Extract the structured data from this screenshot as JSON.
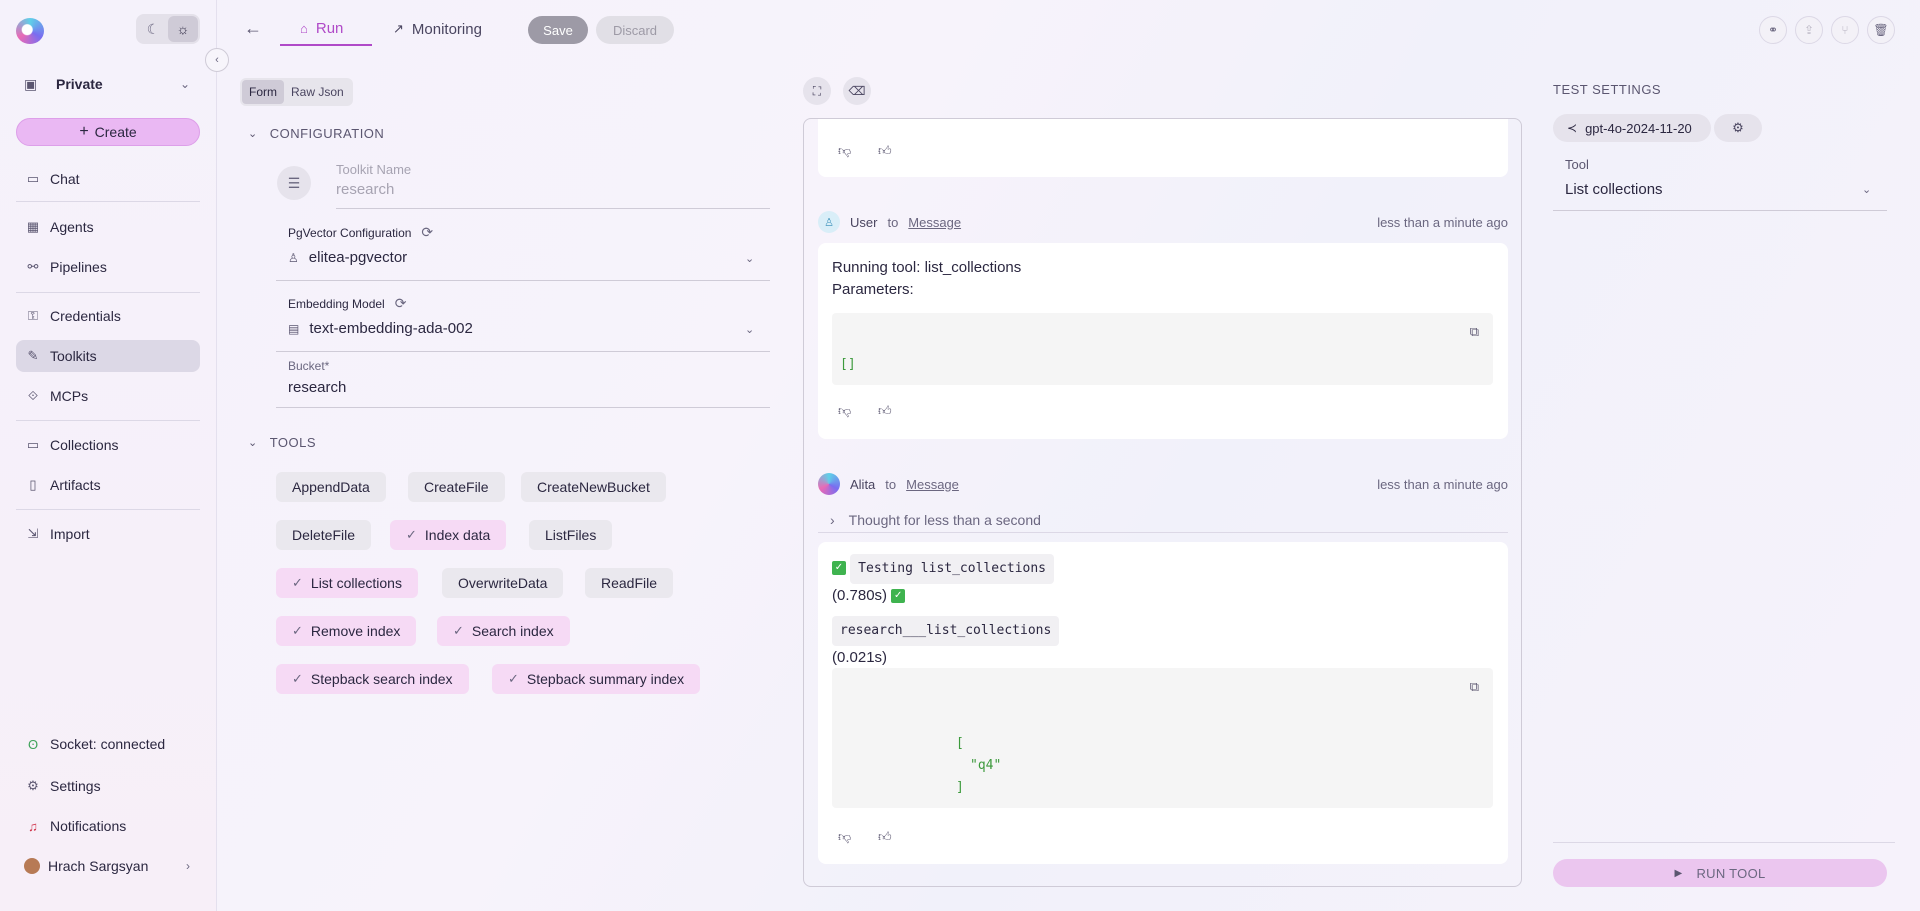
{
  "sidebar": {
    "workspace": "Private",
    "create_label": "Create",
    "items": [
      {
        "label": "Chat",
        "icon": "chat-icon"
      },
      {
        "label": "Agents",
        "icon": "agents-icon"
      },
      {
        "label": "Pipelines",
        "icon": "pipelines-icon"
      },
      {
        "label": "Credentials",
        "icon": "key-icon"
      },
      {
        "label": "Toolkits",
        "icon": "wrench-icon"
      },
      {
        "label": "MCPs",
        "icon": "mcp-icon"
      },
      {
        "label": "Collections",
        "icon": "folder-icon"
      },
      {
        "label": "Artifacts",
        "icon": "file-icon"
      },
      {
        "label": "Import",
        "icon": "import-icon"
      }
    ],
    "bottom": {
      "socket": "Socket: connected",
      "settings": "Settings",
      "notifications": "Notifications",
      "user": "Hrach Sargsyan"
    }
  },
  "topbar": {
    "tabs": [
      {
        "label": "Run",
        "icon": "rocket-icon",
        "active": true
      },
      {
        "label": "Monitoring",
        "icon": "chart-icon",
        "active": false
      }
    ],
    "save_label": "Save",
    "discard_label": "Discard"
  },
  "form": {
    "view_toggle": [
      "Form",
      "Raw Json"
    ],
    "configuration_title": "CONFIGURATION",
    "toolkit_name_label": "Toolkit Name",
    "toolkit_name_value": "research",
    "pgvector_label": "PgVector Configuration",
    "pgvector_value": "elitea-pgvector",
    "embedding_label": "Embedding Model",
    "embedding_value": "text-embedding-ada-002",
    "bucket_label": "Bucket*",
    "bucket_value": "research",
    "tools_title": "TOOLS",
    "tools": [
      {
        "label": "AppendData",
        "selected": false
      },
      {
        "label": "CreateFile",
        "selected": false
      },
      {
        "label": "CreateNewBucket",
        "selected": false
      },
      {
        "label": "DeleteFile",
        "selected": false
      },
      {
        "label": "Index data",
        "selected": true
      },
      {
        "label": "ListFiles",
        "selected": false
      },
      {
        "label": "List collections",
        "selected": true
      },
      {
        "label": "OverwriteData",
        "selected": false
      },
      {
        "label": "ReadFile",
        "selected": false
      },
      {
        "label": "Remove index",
        "selected": true
      },
      {
        "label": "Search index",
        "selected": true
      },
      {
        "label": "Stepback search index",
        "selected": true
      },
      {
        "label": "Stepback summary index",
        "selected": true
      }
    ]
  },
  "chat": {
    "user_msg": {
      "author": "User",
      "to": "to",
      "target": "Message",
      "time": "less than a minute ago",
      "line1": "Running tool: list_collections",
      "line2": "Parameters:",
      "code": "[]"
    },
    "alita_msg": {
      "author": "Alita",
      "to": "to",
      "target": "Message",
      "time": "less than a minute ago",
      "thought": "Thought for less than a second",
      "code1": "Testing list_collections",
      "time1": "(0.780s)",
      "code2": "research___list_collections",
      "time2": "(0.021s)",
      "result_open": "[",
      "result_item": "\"q4\"",
      "result_close": "]"
    }
  },
  "test_settings": {
    "title": "TEST SETTINGS",
    "model": "gpt-4o-2024-11-20",
    "tool_label": "Tool",
    "tool_value": "List collections",
    "run_label": "RUN TOOL"
  }
}
